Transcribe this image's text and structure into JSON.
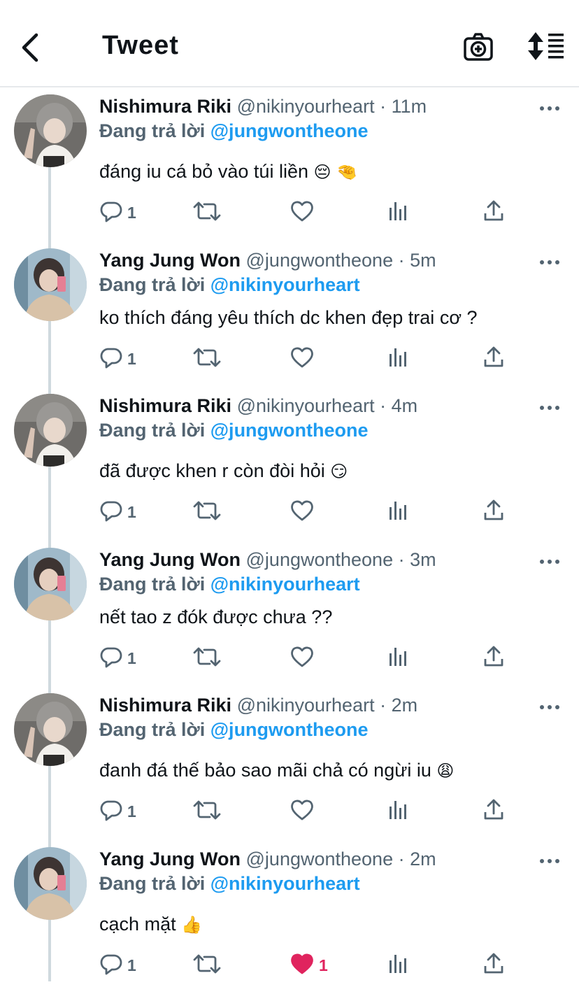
{
  "header": {
    "title": "Tweet",
    "back_icon": "chevron-left-icon",
    "camera_icon": "camera-plus-icon",
    "sort_icon": "sort-icon"
  },
  "colors": {
    "accent": "#1d9bf0",
    "muted": "#536471",
    "like": "#e0245e",
    "divider": "#e6e9ec"
  },
  "reply_prefix": "Đang trả lời",
  "tweets": [
    {
      "name": "Nishimura Riki",
      "handle": "@nikinyourheart",
      "time": "· 11m",
      "reply_to": "@jungwontheone",
      "text": "đáng iu cá bỏ vào túi liền 😔 🤏",
      "replies": "1",
      "likes": "",
      "liked": false,
      "avatar": "riki"
    },
    {
      "name": "Yang Jung Won",
      "handle": "@jungwontheone",
      "time": "· 5m",
      "reply_to": "@nikinyourheart",
      "text": "ko thích đáng yêu thích dc khen đẹp trai cơ ?",
      "replies": "1",
      "likes": "",
      "liked": false,
      "avatar": "jungwon"
    },
    {
      "name": "Nishimura Riki",
      "handle": "@nikinyourheart",
      "time": "· 4m",
      "reply_to": "@jungwontheone",
      "text": "đã được khen r còn đòi hỏi 😏",
      "replies": "1",
      "likes": "",
      "liked": false,
      "avatar": "riki"
    },
    {
      "name": "Yang Jung Won",
      "handle": "@jungwontheone",
      "time": "· 3m",
      "reply_to": "@nikinyourheart",
      "text": "nết tao z đók được chưa ??",
      "replies": "1",
      "likes": "",
      "liked": false,
      "avatar": "jungwon"
    },
    {
      "name": "Nishimura Riki",
      "handle": "@nikinyourheart",
      "time": "· 2m",
      "reply_to": "@jungwontheone",
      "text": "đanh đá thế bảo sao mãi chả có ngừi iu 😩",
      "replies": "1",
      "likes": "",
      "liked": false,
      "avatar": "riki"
    },
    {
      "name": "Yang Jung Won",
      "handle": "@jungwontheone",
      "time": "· 2m",
      "reply_to": "@nikinyourheart",
      "text": "cạch mặt 👍",
      "replies": "1",
      "likes": "1",
      "liked": true,
      "avatar": "jungwon"
    }
  ]
}
